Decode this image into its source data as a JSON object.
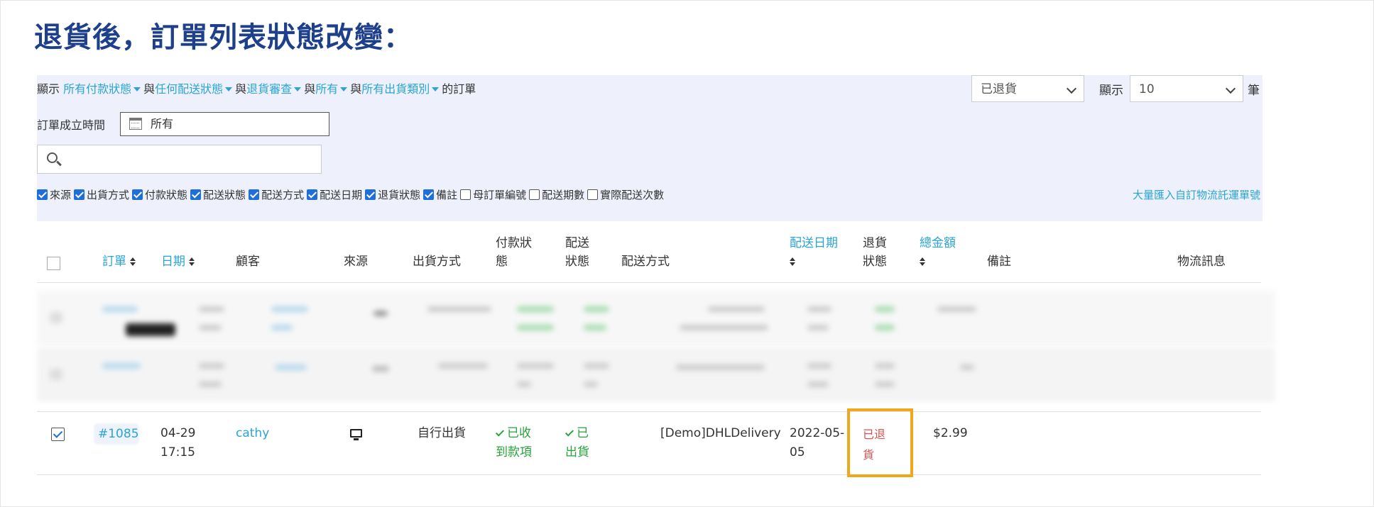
{
  "heading": "退貨後，訂單列表狀態改變：",
  "filters": {
    "prefix": "顯示",
    "payment": "所有付款狀態",
    "join1": "與",
    "delivery": "任何配送狀態",
    "join2": "與",
    "return_review": "退貨審查",
    "join3": "與",
    "all": "所有",
    "join4": "與",
    "shipment_type": "所有出貨類別",
    "suffix": "的訂單",
    "status_select": "已退貨",
    "show_label": "顯示",
    "page_size": "10",
    "unit": "筆",
    "created_label": "訂單成立時間",
    "created_value": "所有",
    "search_placeholder": ""
  },
  "columns_toggle": [
    {
      "label": "來源",
      "checked": true
    },
    {
      "label": "出貨方式",
      "checked": true
    },
    {
      "label": "付款狀態",
      "checked": true
    },
    {
      "label": "配送狀態",
      "checked": true
    },
    {
      "label": "配送方式",
      "checked": true
    },
    {
      "label": "配送日期",
      "checked": true
    },
    {
      "label": "退貨狀態",
      "checked": true
    },
    {
      "label": "備註",
      "checked": true
    },
    {
      "label": "母訂單編號",
      "checked": false
    },
    {
      "label": "配送期數",
      "checked": false
    },
    {
      "label": "實際配送次數",
      "checked": false
    }
  ],
  "bulk_import": "大量匯入自訂物流託運單號",
  "table_headers": {
    "order": "訂單",
    "date": "日期",
    "customer": "顧客",
    "source": "來源",
    "shipping_method": "出貨方式",
    "payment_status_1": "付款狀",
    "payment_status_2": "態",
    "delivery_status_1": "配送",
    "delivery_status_2": "狀態",
    "delivery_method": "配送方式",
    "delivery_date": "配送日期",
    "return_status_1": "退貨",
    "return_status_2": "狀態",
    "total": "總金額",
    "notes": "備註",
    "logistics": "物流訊息"
  },
  "row": {
    "order": "#1085",
    "date_1": "04-29",
    "date_2": "17:15",
    "customer": "cathy",
    "shipping_method": "自行出貨",
    "payment_1": "已收",
    "payment_2": "到款項",
    "delivery_1": "已",
    "delivery_2": "出貨",
    "delivery_method": "[Demo]DHLDelivery",
    "delivery_date_1": "2022-05-",
    "delivery_date_2": "05",
    "return_1": "已退",
    "return_2": "貨",
    "total": "$2.99",
    "source_icon": "desktop-monitor-icon"
  },
  "colors": {
    "heading": "#1d3f8c",
    "link": "#2aa4d5",
    "success": "#27a23c",
    "returned": "#d9534f",
    "highlight": "#f0a81a"
  }
}
